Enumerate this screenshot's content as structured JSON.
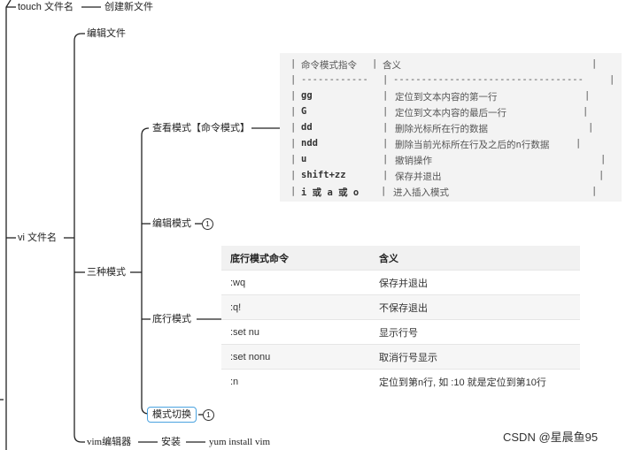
{
  "mindmap": {
    "touch_cmd": "touch 文件名",
    "touch_desc": "创建新文件",
    "vi_cmd": "vi 文件名",
    "edit_file": "编辑文件",
    "three_modes": "三种模式",
    "view_mode": "查看模式【命令模式】",
    "edit_mode": "编辑模式",
    "edit_mode_badge": "1",
    "bottom_mode": "底行模式",
    "mode_switch": "模式切换",
    "mode_switch_badge": "1",
    "vim_editor": "vim编辑器",
    "install": "安装",
    "install_cmd": "yum install vim"
  },
  "command_table": {
    "header": [
      "命令模式指令",
      "含义"
    ],
    "separator": "------------",
    "separator2": "----------------------------------",
    "rows": [
      {
        "cmd": "gg",
        "desc": "定位到文本内容的第一行"
      },
      {
        "cmd": "G",
        "desc": "定位到文本内容的最后一行"
      },
      {
        "cmd": "dd",
        "desc": "删除光标所在行的数据"
      },
      {
        "cmd": "ndd",
        "desc": "删除当前光标所在行及之后的n行数据"
      },
      {
        "cmd": "u",
        "desc": "撤销操作"
      },
      {
        "cmd": "shift+zz",
        "desc": "保存并退出"
      },
      {
        "cmd": "i 或 a 或 o",
        "desc": "进入插入模式"
      }
    ]
  },
  "bottom_table": {
    "headers": [
      "底行模式命令",
      "含义"
    ],
    "rows": [
      [
        ":wq",
        "保存并退出"
      ],
      [
        ":q!",
        "不保存退出"
      ],
      [
        ":set nu",
        "显示行号"
      ],
      [
        ":set nonu",
        "取消行号显示"
      ],
      [
        ":n",
        "定位到第n行, 如 :10 就是定位到第10行"
      ]
    ]
  },
  "watermark": "CSDN @星晨鱼95"
}
